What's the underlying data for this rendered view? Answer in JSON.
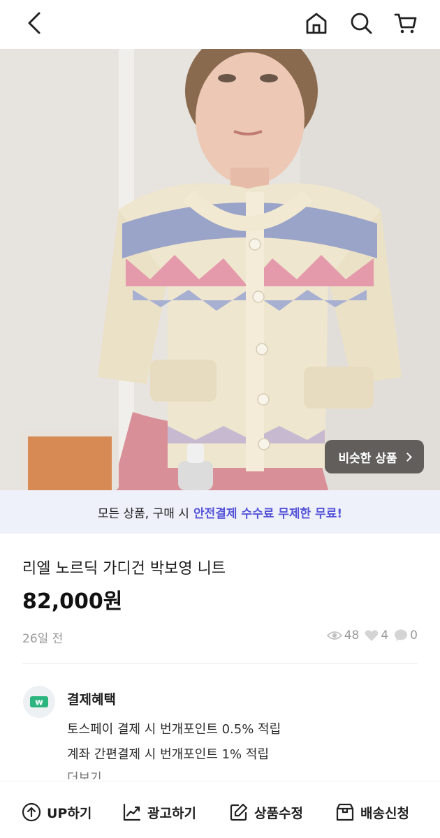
{
  "header": {
    "back_icon": "chevron-left-icon",
    "home_icon": "home-icon",
    "search_icon": "search-icon",
    "cart_icon": "cart-icon"
  },
  "hero": {
    "similar_button_label": "비슷한 상품"
  },
  "banner": {
    "text_prefix": "모든 상품, 구매 시",
    "text_highlight": "안전결제 수수료 무제한 무료!",
    "highlight_color": "#5554d8"
  },
  "product": {
    "title": "리엘 노르딕 가디건 박보영 니트",
    "price": "82,000원",
    "posted": "26일 전",
    "views": "48",
    "likes": "4",
    "chats": "0"
  },
  "benefits": {
    "title": "결제혜택",
    "icon": "wallet-icon",
    "line1": "토스페이 결제 시 번개포인트 0.5% 적립",
    "line2": "계좌 간편결제 시 번개포인트 1% 적립",
    "more": "더보기"
  },
  "bottom_bar": {
    "up": "UP하기",
    "ad": "광고하기",
    "edit": "상품수정",
    "ship": "배송신청"
  }
}
